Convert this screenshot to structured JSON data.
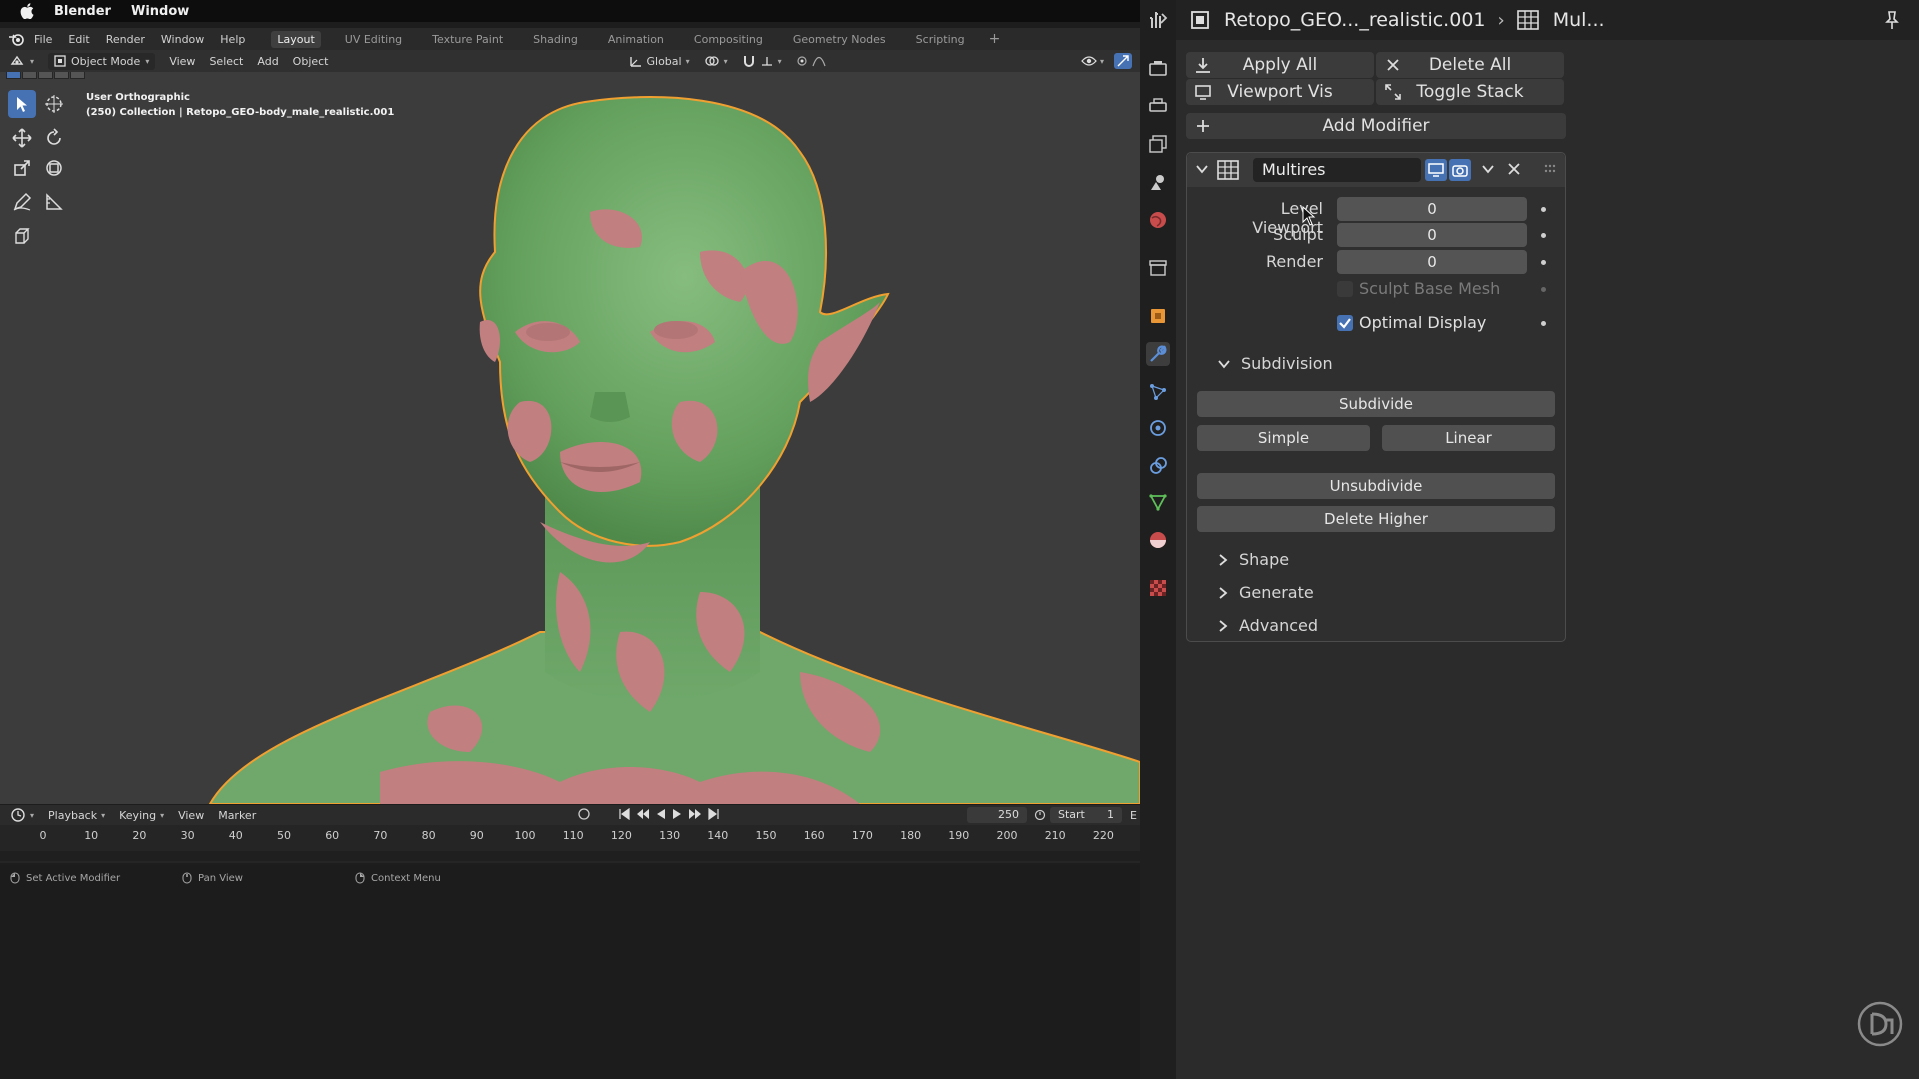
{
  "menubar": {
    "app_name": "Blender",
    "items": [
      "Window"
    ]
  },
  "topbar": {
    "menus": [
      "File",
      "Edit",
      "Render",
      "Window",
      "Help"
    ],
    "workspaces": [
      "Layout",
      "UV Editing",
      "Texture Paint",
      "Shading",
      "Animation",
      "Compositing",
      "Geometry Nodes",
      "Scripting"
    ],
    "active_workspace": "Layout",
    "add_workspace": "+"
  },
  "viewport_header": {
    "mode": "Object Mode",
    "menus": [
      "View",
      "Select",
      "Add",
      "Object"
    ],
    "orientation": "Global"
  },
  "viewport": {
    "view_name": "User Orthographic",
    "collection_info": "(250) Collection | Retopo_GEO-body_male_realistic.001"
  },
  "timeline": {
    "menus": [
      "Playback",
      "Keying",
      "View",
      "Marker"
    ],
    "current_frame": "250",
    "start_label": "Start",
    "start_value": "1",
    "end_label": "E",
    "ticks": [
      "0",
      "10",
      "20",
      "30",
      "40",
      "50",
      "60",
      "70",
      "80",
      "90",
      "100",
      "110",
      "120",
      "130",
      "140",
      "150",
      "160",
      "170",
      "180",
      "190",
      "200",
      "210",
      "220"
    ]
  },
  "statusbar": {
    "left": "Set Active Modifier",
    "middle": "Pan View",
    "right": "Context Menu"
  },
  "properties": {
    "breadcrumb_object": "Retopo_GEO..._realistic.001",
    "breadcrumb_modifier": "Mul...",
    "apply_all": "Apply All",
    "delete_all": "Delete All",
    "viewport_vis": "Viewport Vis",
    "toggle_stack": "Toggle Stack",
    "add_modifier": "Add Modifier",
    "modifier": {
      "name": "Multires",
      "level_viewport_label": "Level Viewport",
      "level_viewport_value": "0",
      "sculpt_label": "Sculpt",
      "sculpt_value": "0",
      "render_label": "Render",
      "render_value": "0",
      "sculpt_base_mesh_label": "Sculpt Base Mesh",
      "sculpt_base_mesh_checked": false,
      "optimal_display_label": "Optimal Display",
      "optimal_display_checked": true,
      "subdivision_section": "Subdivision",
      "subdivide": "Subdivide",
      "simple": "Simple",
      "linear": "Linear",
      "unsubdivide": "Unsubdivide",
      "delete_higher": "Delete Higher",
      "shape_section": "Shape",
      "generate_section": "Generate",
      "advanced_section": "Advanced"
    }
  },
  "colors": {
    "accent": "#4672b4",
    "mesh_green": "#6fa86a",
    "mesh_pink": "#c27f7f",
    "selection_outline": "#f0a030",
    "viewport_bg": "#3c3c3c"
  }
}
